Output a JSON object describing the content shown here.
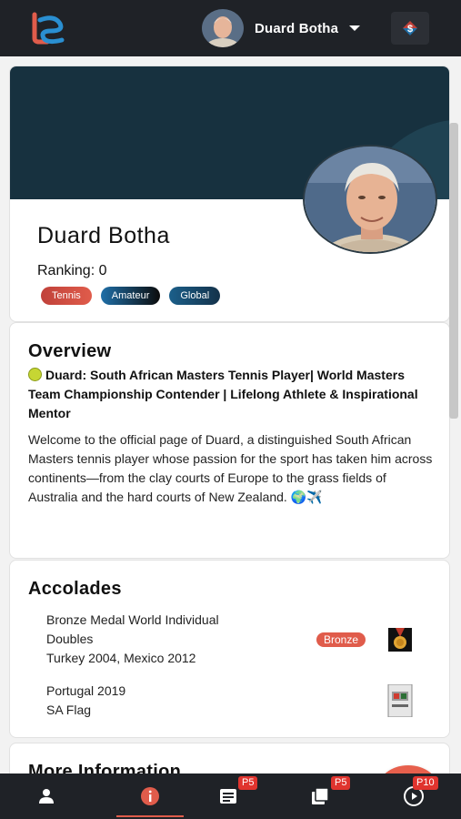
{
  "header": {
    "user_name": "Duard Botha",
    "logo_icon": "brand-logo-icon",
    "wallet_icon": "wallet-dollar-icon"
  },
  "profile": {
    "name": "Duard Botha",
    "ranking": "Ranking: 0",
    "badges": [
      "Tennis",
      "Amateur",
      "Global"
    ]
  },
  "overview": {
    "title": "Overview",
    "headline": "Duard: South African Masters Tennis Player| World Masters Team Championship Contender | Lifelong Athlete & Inspirational Mentor",
    "body": "Welcome to the official page of Duard, a distinguished South African Masters tennis player whose passion for the sport has taken him across continents—from the clay courts of Europe to the grass fields of Australia and the hard courts of New Zealand. 🌍✈️"
  },
  "accolades": {
    "title": "Accolades",
    "items": [
      {
        "line1": "Bronze Medal World Individual",
        "line2": "Doubles",
        "line3": "Turkey 2004, Mexico 2012",
        "tag": "Bronze",
        "icon": "medal-icon"
      },
      {
        "line1": "Portugal 2019",
        "line2": "SA Flag",
        "icon": "flag-icon"
      }
    ]
  },
  "more_info": {
    "title": "More Information"
  },
  "fab": {
    "icon": "pencil-icon"
  },
  "bottom_nav": {
    "items": [
      {
        "icon": "person-icon",
        "badge": ""
      },
      {
        "icon": "info-icon",
        "badge": ""
      },
      {
        "icon": "list-icon",
        "badge": "P5"
      },
      {
        "icon": "library-icon",
        "badge": "P5"
      },
      {
        "icon": "play-icon",
        "badge": "P10"
      }
    ]
  },
  "colors": {
    "accent": "#e05c4b",
    "topbar": "#1f2227",
    "cover": "#17313f"
  }
}
